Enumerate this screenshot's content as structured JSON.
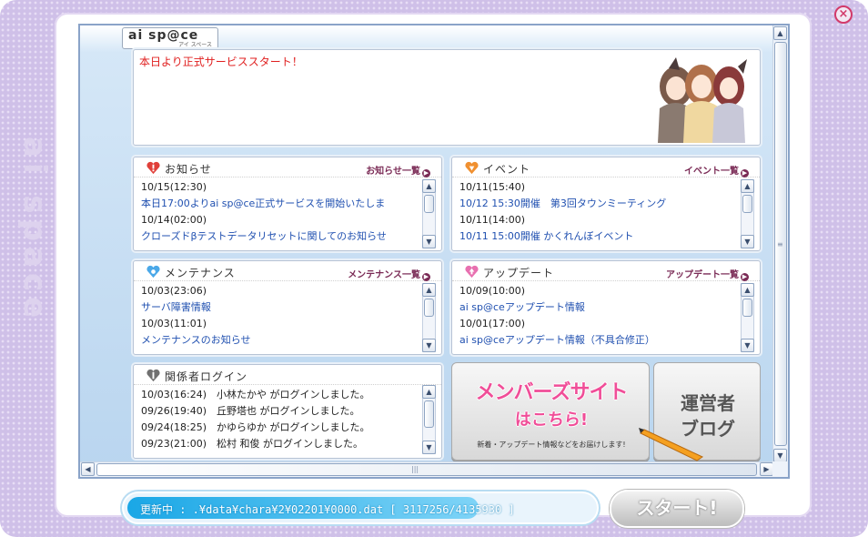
{
  "window": {
    "close_glyph": "×",
    "side_logo": "ai space"
  },
  "logo": {
    "main": "ai sp@ce",
    "sub": "アイ スペース"
  },
  "banner": {
    "message": "本日より正式サービススタート！"
  },
  "panels": {
    "news": {
      "title": "お知らせ",
      "more": "お知らせ一覧",
      "icon": "heart-exclaim-icon",
      "color": "#e0403a",
      "items": [
        {
          "date": "10/15(12:30)",
          "text": "本日17:00よりai sp@ce正式サービスを開始いたしま"
        },
        {
          "date": "10/14(02:00)",
          "text": "クローズドβテストデータリセットに関してのお知らせ"
        }
      ]
    },
    "event": {
      "title": "イベント",
      "more": "イベント一覧",
      "icon": "heart-event-icon",
      "color": "#f09030",
      "items": [
        {
          "date": "10/11(15:40)",
          "text": "10/12 15:30開催　第3回タウンミーティング"
        },
        {
          "date": "10/11(14:00)",
          "text": "10/11 15:00開催 かくれんぼイベント"
        }
      ]
    },
    "maintenance": {
      "title": "メンテナンス",
      "more": "メンテナンス一覧",
      "icon": "heart-maint-icon",
      "color": "#4aa8e8",
      "items": [
        {
          "date": "10/03(23:06)",
          "text": "サーバ障害情報"
        },
        {
          "date": "10/03(11:01)",
          "text": "メンテナンスのお知らせ"
        }
      ]
    },
    "update": {
      "title": "アップデート",
      "more": "アップデート一覧",
      "icon": "heart-update-icon",
      "color": "#e870b0",
      "items": [
        {
          "date": "10/09(10:00)",
          "text": "ai sp@ceアップデート情報"
        },
        {
          "date": "10/01(17:00)",
          "text": "ai sp@ceアップデート情報（不具合修正）"
        }
      ]
    },
    "login": {
      "title": "関係者ログイン",
      "icon": "heart-login-icon",
      "color": "#707070",
      "items": [
        "10/03(16:24)　小林たかや がログインしました。",
        "09/26(19:40)　丘野塔也 がログインしました。",
        "09/24(18:25)　かゆらゆか がログインしました。",
        "09/23(21:00)　松村 和俊 がログインしました。"
      ]
    }
  },
  "members_button": {
    "title": "メンバーズサイト",
    "sub": "はこちら!",
    "note": "新着・アップデート情報などをお届けします!"
  },
  "blog_button": {
    "line1": "運営者",
    "line2": "ブログ"
  },
  "status": {
    "text": "更新中 : .¥data¥chara¥2¥02201¥0000.dat [ 3117256/4135930 ]",
    "progress": 0.754
  },
  "start_button": {
    "label": "スタート!"
  }
}
